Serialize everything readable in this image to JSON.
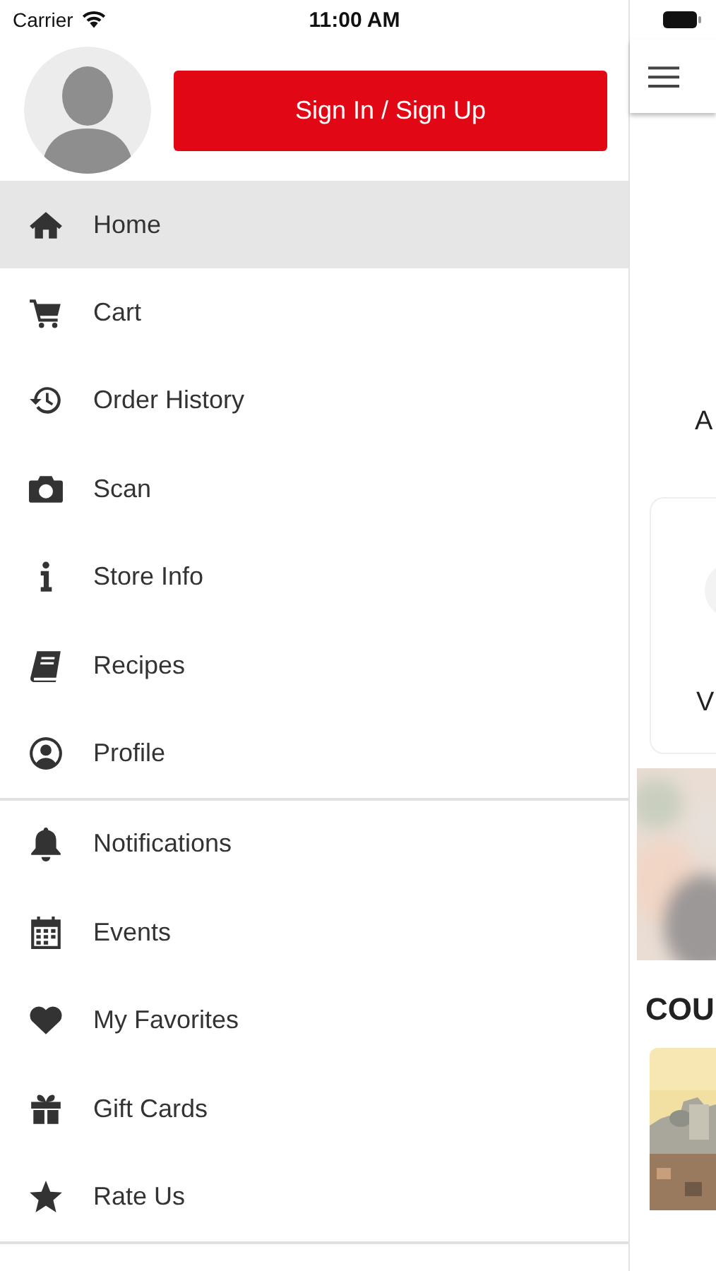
{
  "status_bar": {
    "carrier": "Carrier",
    "time": "11:00 AM"
  },
  "drawer": {
    "sign_in_button": "Sign In / Sign Up",
    "groups": [
      {
        "items": [
          {
            "label": "Home",
            "selected": true
          },
          {
            "label": "Cart",
            "selected": false
          },
          {
            "label": "Order History",
            "selected": false
          },
          {
            "label": "Scan",
            "selected": false
          },
          {
            "label": "Store Info",
            "selected": false
          },
          {
            "label": "Recipes",
            "selected": false
          },
          {
            "label": "Profile",
            "selected": false
          }
        ]
      },
      {
        "items": [
          {
            "label": "Notifications",
            "selected": false
          },
          {
            "label": "Events",
            "selected": false
          },
          {
            "label": "My Favorites",
            "selected": false
          },
          {
            "label": "Gift Cards",
            "selected": false
          },
          {
            "label": "Rate Us",
            "selected": false
          }
        ]
      }
    ]
  },
  "main": {
    "text_1": "A",
    "card_text": "V",
    "section_heading": "COU"
  }
}
